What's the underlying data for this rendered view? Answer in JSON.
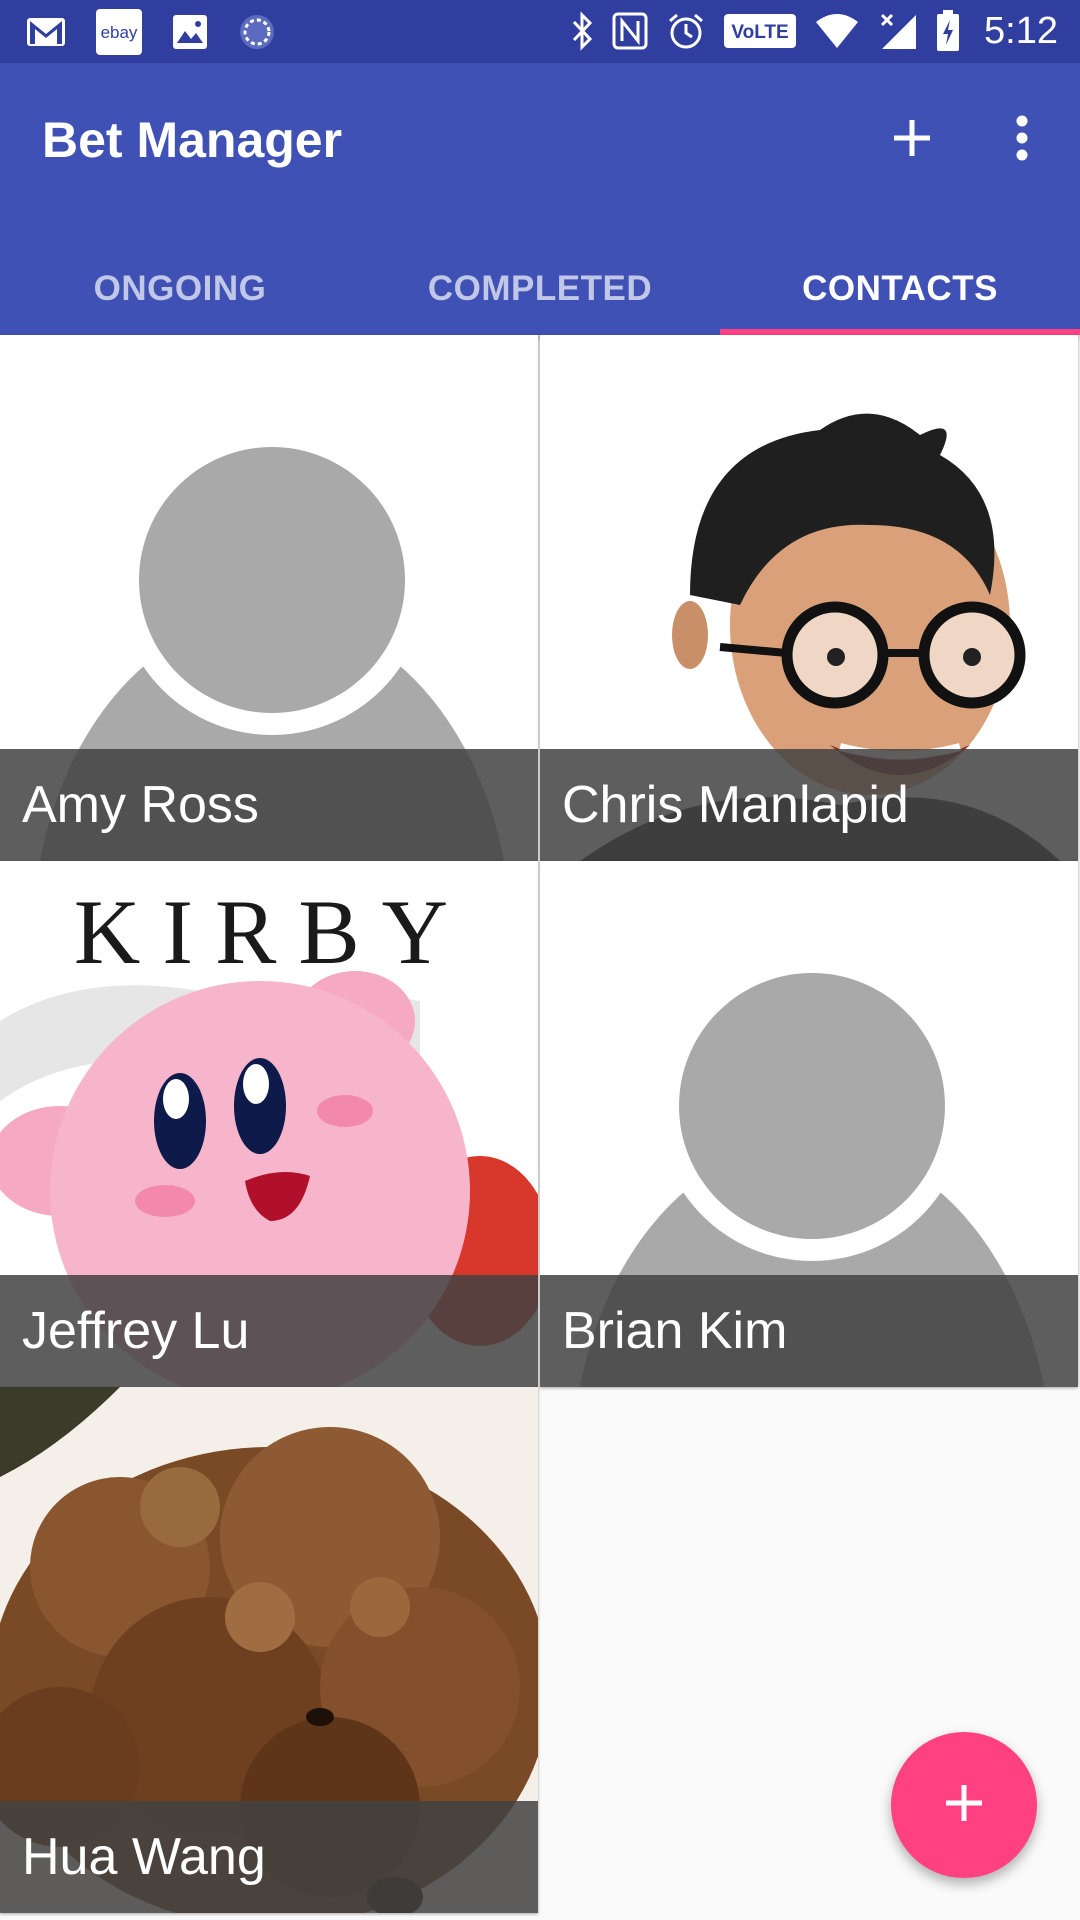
{
  "status_bar": {
    "time": "5:12",
    "left_icons": [
      "gmail-icon",
      "ebay-icon",
      "gallery-icon",
      "sync-icon"
    ],
    "ebay_text": "ebay",
    "volte_text": "VoLTE"
  },
  "app_bar": {
    "title": "Bet Manager",
    "add_icon": "plus-icon",
    "overflow_icon": "more-vert-icon",
    "background": "#3f51b5",
    "status_background": "#303f9f"
  },
  "tabs": [
    {
      "label": "ONGOING",
      "active": false
    },
    {
      "label": "COMPLETED",
      "active": false
    },
    {
      "label": "CONTACTS",
      "active": true
    }
  ],
  "accent": "#ff4081",
  "contacts": [
    {
      "name": "Amy Ross",
      "photo": "default-avatar"
    },
    {
      "name": "Chris Manlapid",
      "photo": "man-with-glasses"
    },
    {
      "name": "Jeffrey Lu",
      "photo": "kirby",
      "photo_text": "KIRBY"
    },
    {
      "name": "Brian Kim",
      "photo": "default-avatar"
    },
    {
      "name": "Hua Wang",
      "photo": "brown-poodle"
    }
  ],
  "fab": {
    "icon": "plus-icon"
  }
}
